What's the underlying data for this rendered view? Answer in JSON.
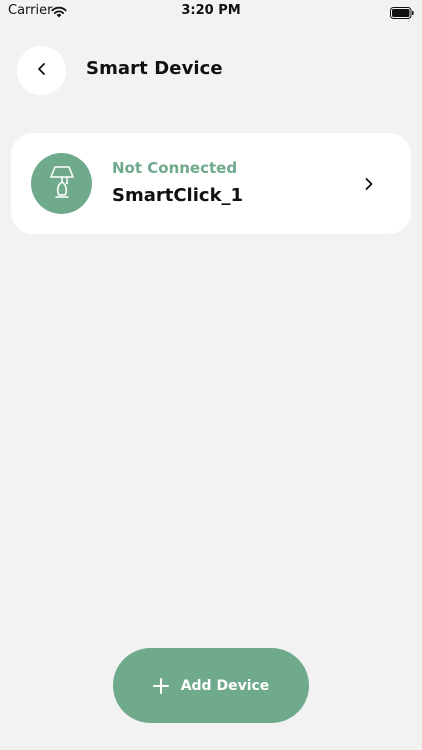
{
  "status_bar": {
    "carrier": "Carrier",
    "time": "3:20 PM",
    "icons": [
      "wifi-icon",
      "battery-icon"
    ]
  },
  "header": {
    "title": "Smart Device",
    "back_icon": "chevron-left-icon"
  },
  "device": {
    "status": "Not Connected",
    "name": "SmartClick_1",
    "icon": "lamp-icon",
    "chevron_icon": "chevron-right-icon"
  },
  "actions": {
    "add_label": "Add Device",
    "add_icon": "plus-icon"
  },
  "colors": {
    "accent": "#6faa8d",
    "background": "#f2f2f2",
    "card": "#ffffff"
  }
}
